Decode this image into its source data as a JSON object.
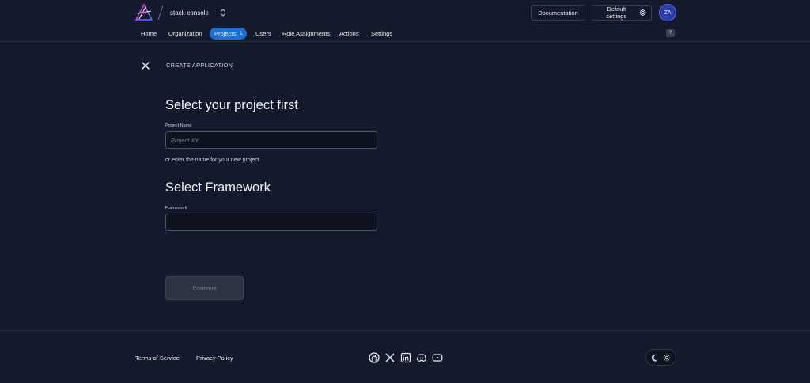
{
  "header": {
    "org_name": "stack-console",
    "docs_label": "Documentation",
    "settings_label": "Default settings",
    "avatar_initials": "ZA",
    "help_label": "?"
  },
  "nav": {
    "items": [
      {
        "label": "Home"
      },
      {
        "label": "Organization"
      },
      {
        "label": "Projects",
        "badge": "1",
        "active": true
      },
      {
        "label": "Users"
      },
      {
        "label": "Role Assignments"
      },
      {
        "label": "Actions"
      },
      {
        "label": "Settings"
      }
    ]
  },
  "main": {
    "page_label": "CREATE APPLICATION",
    "project_title": "Select your project first",
    "project_label": "Project Name",
    "project_placeholder": "Project XY",
    "project_value": "",
    "hint": "or enter the name for your new project",
    "framework_title": "Select Framework",
    "framework_label": "Framework",
    "framework_value": "",
    "continue_label": "Continue"
  },
  "footer": {
    "terms_label": "Terms of Service",
    "privacy_label": "Privacy Policy",
    "social_icons": [
      "github-icon",
      "x-icon",
      "linkedin-icon",
      "discord-icon",
      "youtube-icon"
    ],
    "theme_options": [
      "moon-icon",
      "sun-icon"
    ]
  },
  "colors": {
    "background": "#141a2b",
    "accent": "#1d6fd3",
    "avatar": "#2d3ca8",
    "button_disabled": "#2e3444"
  }
}
